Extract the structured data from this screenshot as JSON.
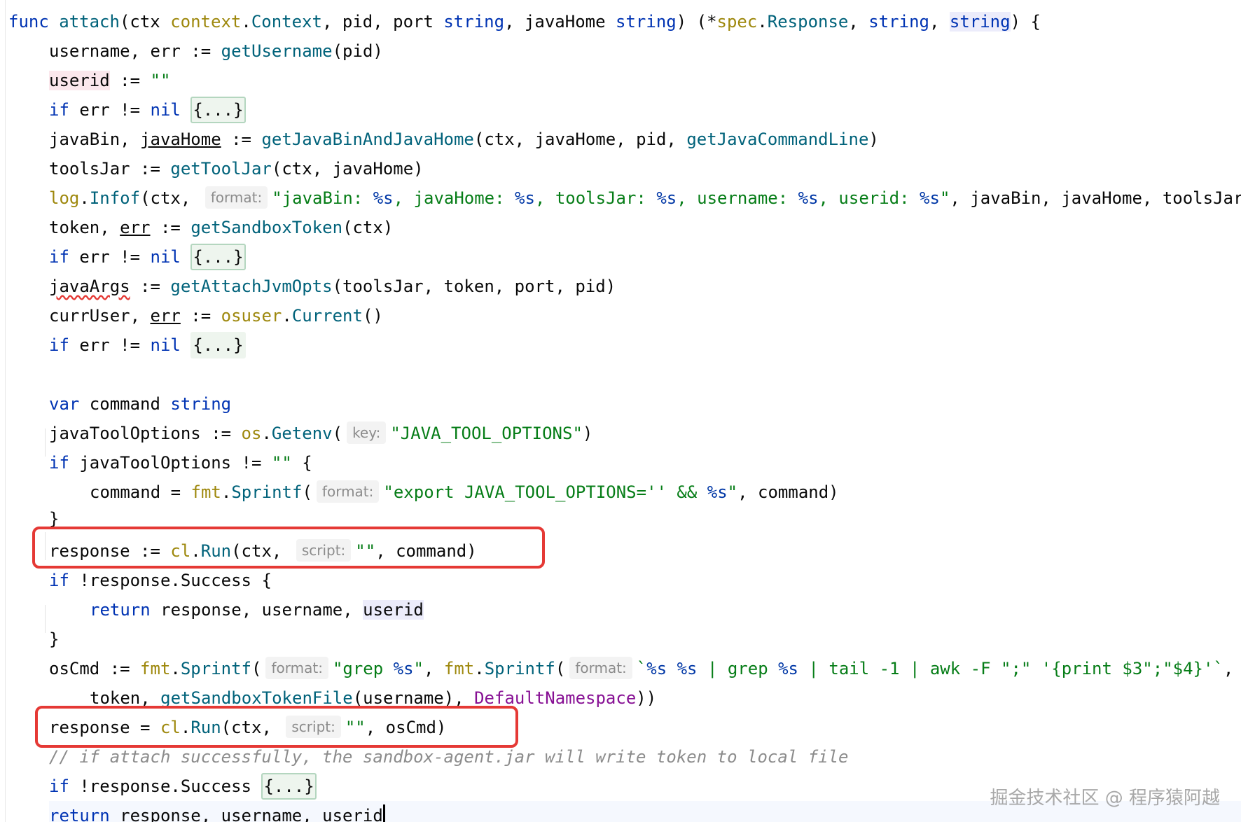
{
  "editor": {
    "language": "go",
    "watermark": "掘金技术社区 @ 程序猿阿越",
    "lines": {
      "l1": [
        "func",
        " ",
        "attach",
        "(ctx ",
        "context",
        ".",
        "Context",
        ", pid, port ",
        "string",
        ", javaHome ",
        "string",
        ") (*",
        "spec",
        ".",
        "Response",
        ", ",
        "string",
        ", ",
        "string",
        ") {"
      ],
      "l2": [
        "username, err := ",
        "getUsername",
        "(pid)"
      ],
      "l3": [
        "userid",
        " := ",
        "\"\""
      ],
      "l4": [
        "if",
        " err != ",
        "nil",
        " ",
        "{...}"
      ],
      "l5": [
        "javaBin, ",
        "javaHome",
        " := ",
        "getJavaBinAndJavaHome",
        "(ctx, javaHome, pid, ",
        "getJavaCommandLine",
        ")"
      ],
      "l6": [
        "toolsJar := ",
        "getToolJar",
        "(ctx, javaHome)"
      ],
      "l7": [
        "log",
        ".",
        "Infof",
        "(ctx, ",
        "format:",
        "\"javaBin: ",
        "%s",
        ", javaHome: ",
        "%s",
        ", toolsJar: ",
        "%s",
        ", username: ",
        "%s",
        ", userid: ",
        "%s",
        "\"",
        ", javaBin, javaHome, toolsJar"
      ],
      "l8": [
        "token, ",
        "err",
        " := ",
        "getSandboxToken",
        "(ctx)"
      ],
      "l9": [
        "if",
        " err != ",
        "nil",
        " ",
        "{...}"
      ],
      "l10": [
        "javaArgs",
        " := ",
        "getAttachJvmOpts",
        "(toolsJar, token, port, pid)"
      ],
      "l11": [
        "currUser, ",
        "err",
        " := ",
        "osuser",
        ".",
        "Current",
        "()"
      ],
      "l12": [
        "if",
        " err != ",
        "nil",
        " ",
        "{...}"
      ],
      "l14": [
        "var",
        " command ",
        "string"
      ],
      "l15": [
        "javaToolOptions := ",
        "os",
        ".",
        "Getenv",
        "(",
        "key:",
        "\"JAVA_TOOL_OPTIONS\"",
        ")"
      ],
      "l16": [
        "if",
        " javaToolOptions != ",
        "\"\"",
        " {"
      ],
      "l17": [
        "command = ",
        "fmt",
        ".",
        "Sprintf",
        "(",
        "format:",
        "\"export JAVA_TOOL_OPTIONS='' && ",
        "%s",
        "\"",
        ", command)"
      ],
      "l18": [
        "}"
      ],
      "l19": [
        "response := ",
        "cl",
        ".",
        "Run",
        "(ctx, ",
        "script:",
        "\"\"",
        ", command)"
      ],
      "l20": [
        "if",
        " !response.Success {"
      ],
      "l21": [
        "return",
        " response, username, ",
        "userid"
      ],
      "l22": [
        "}"
      ],
      "l23": [
        "osCmd := ",
        "fmt",
        ".",
        "Sprintf",
        "(",
        "format:",
        "\"grep ",
        "%s",
        "\"",
        ", ",
        "fmt",
        ".",
        "Sprintf",
        "(",
        "format:",
        "`",
        "%s",
        " ",
        "%s",
        " | grep ",
        "%s",
        " | tail -1 | awk -F \";\" '{print $3\";\"$4}'`",
        ","
      ],
      "l24": [
        "token, ",
        "getSandboxTokenFile",
        "(username), ",
        "DefaultNamespace",
        "))"
      ],
      "l25": [
        "response = ",
        "cl",
        ".",
        "Run",
        "(ctx, ",
        "script:",
        "\"\"",
        ", osCmd)"
      ],
      "l26": [
        "// if attach successfully, the sandbox-agent.jar will write token to local file"
      ],
      "l27": [
        "if",
        " !response.Success ",
        "{...}"
      ],
      "l28": [
        "return",
        " response, username, userid"
      ]
    }
  }
}
